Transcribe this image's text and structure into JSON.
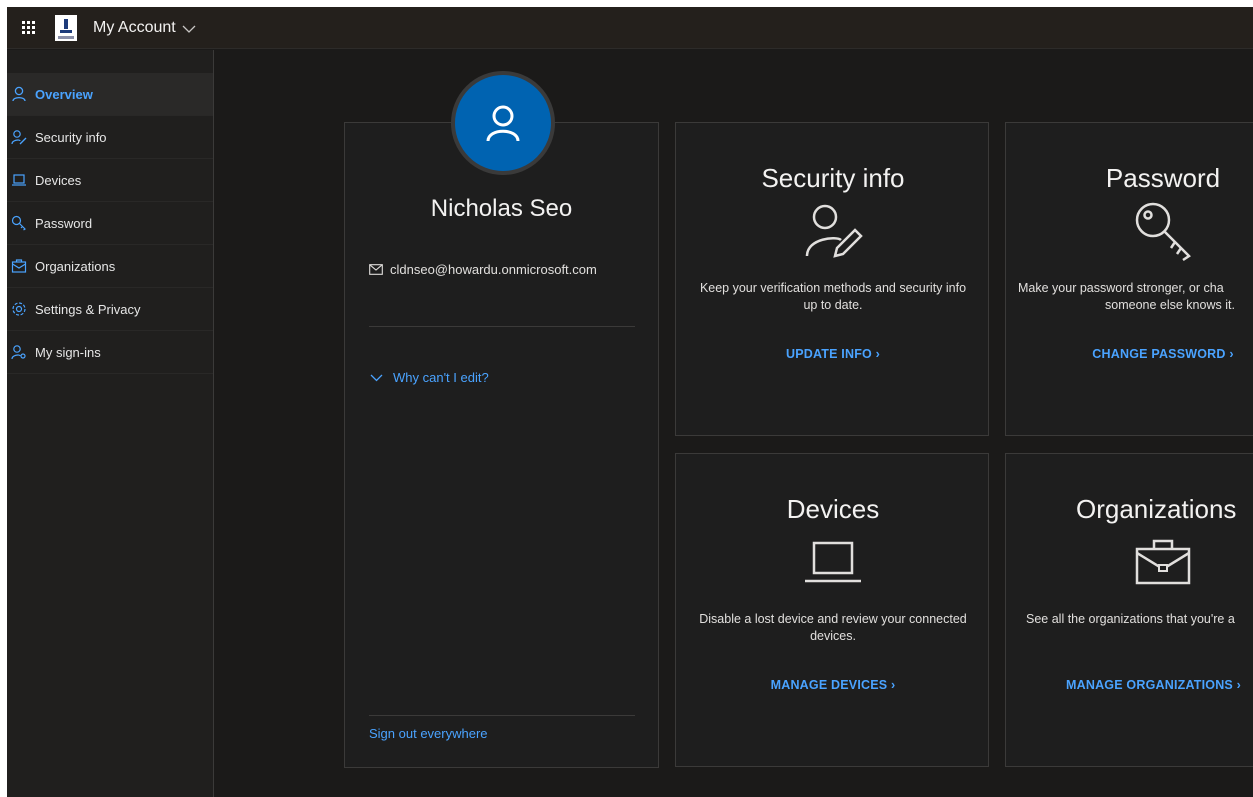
{
  "header": {
    "app_title": "My Account"
  },
  "sidebar": {
    "items": [
      {
        "label": "Overview",
        "icon": "person-icon",
        "active": true
      },
      {
        "label": "Security info",
        "icon": "person-key-icon"
      },
      {
        "label": "Devices",
        "icon": "laptop-icon"
      },
      {
        "label": "Password",
        "icon": "key-icon"
      },
      {
        "label": "Organizations",
        "icon": "briefcase-icon"
      },
      {
        "label": "Settings & Privacy",
        "icon": "gear-icon"
      },
      {
        "label": "My sign-ins",
        "icon": "person-key-icon"
      }
    ]
  },
  "profile": {
    "name": "Nicholas Seo",
    "email": "cldnseo@howardu.onmicrosoft.com",
    "why_edit": "Why can't I edit?",
    "sign_out": "Sign out everywhere"
  },
  "cards": {
    "security": {
      "title": "Security info",
      "description": "Keep your verification methods and security info up to date.",
      "link": "UPDATE INFO"
    },
    "password": {
      "title": "Password",
      "description_line1": "Make your password stronger, or cha",
      "description_line2": "someone else knows it.",
      "link": "CHANGE PASSWORD"
    },
    "devices": {
      "title": "Devices",
      "description": "Disable a lost device and review your connected devices.",
      "link": "MANAGE DEVICES"
    },
    "organizations": {
      "title": "Organizations",
      "description": "See all the organizations that you're a",
      "link": "MANAGE ORGANIZATIONS"
    }
  },
  "colors": {
    "accent": "#4aa3ff",
    "avatar": "#0063b1",
    "background": "#1b1a19"
  }
}
